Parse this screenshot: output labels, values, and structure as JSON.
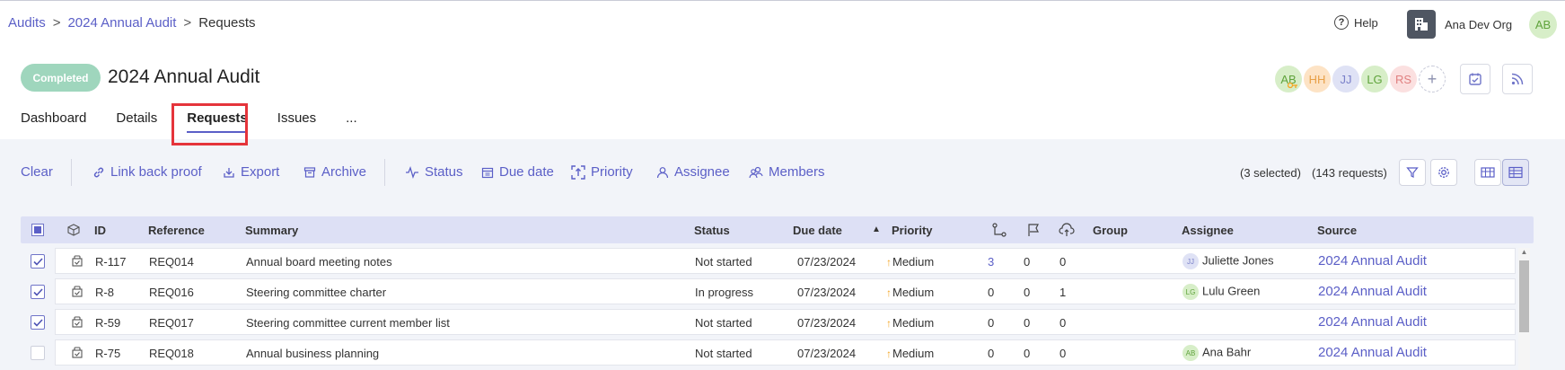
{
  "breadcrumb": {
    "root": "Audits",
    "sep1": ">",
    "parent": "2024 Annual Audit",
    "sep2": ">",
    "current": "Requests"
  },
  "topbar": {
    "help_label": "Help",
    "org_name": "Ana Dev Org",
    "user_initials": "AB"
  },
  "header": {
    "status": "Completed",
    "title": "2024 Annual Audit",
    "members": [
      {
        "initials": "AB",
        "bg": "#d7eec8",
        "fg": "#5fa33b"
      },
      {
        "initials": "HH",
        "bg": "#fde3c5",
        "fg": "#e8a047"
      },
      {
        "initials": "JJ",
        "bg": "#dfe2f5",
        "fg": "#7a80c9"
      },
      {
        "initials": "LG",
        "bg": "#d7eec8",
        "fg": "#5fa33b"
      },
      {
        "initials": "RS",
        "bg": "#fbe0e0",
        "fg": "#e08080"
      }
    ],
    "add_member": "+"
  },
  "tabs": [
    {
      "label": "Dashboard",
      "active": false
    },
    {
      "label": "Details",
      "active": false
    },
    {
      "label": "Requests",
      "active": true
    },
    {
      "label": "Issues",
      "active": false
    },
    {
      "label": "...",
      "active": false
    }
  ],
  "toolbar": {
    "clear": "Clear",
    "link_back_proof": "Link back proof",
    "export": "Export",
    "archive": "Archive",
    "status": "Status",
    "due_date": "Due date",
    "priority": "Priority",
    "assignee": "Assignee",
    "members": "Members",
    "selected_count": "(3 selected)",
    "request_count": "(143 requests)"
  },
  "table": {
    "headers": {
      "id": "ID",
      "reference": "Reference",
      "summary": "Summary",
      "status": "Status",
      "due_date": "Due date",
      "priority": "Priority",
      "group": "Group",
      "assignee": "Assignee",
      "source": "Source"
    },
    "rows": [
      {
        "checked": true,
        "id": "R-117",
        "reference": "REQ014",
        "summary": "Annual board meeting notes",
        "status": "Not started",
        "due_date": "07/23/2024",
        "priority": "Medium",
        "subtasks": "3",
        "flags": "0",
        "uploads": "0",
        "group": "",
        "assignee_initials": "JJ",
        "assignee": "Juliette Jones",
        "source": "2024 Annual Audit"
      },
      {
        "checked": true,
        "id": "R-8",
        "reference": "REQ016",
        "summary": "Steering committee charter",
        "status": "In progress",
        "due_date": "07/23/2024",
        "priority": "Medium",
        "subtasks": "0",
        "flags": "0",
        "uploads": "1",
        "group": "",
        "assignee_initials": "LG",
        "assignee": "Lulu Green",
        "source": "2024 Annual Audit"
      },
      {
        "checked": true,
        "id": "R-59",
        "reference": "REQ017",
        "summary": "Steering committee current member list",
        "status": "Not started",
        "due_date": "07/23/2024",
        "priority": "Medium",
        "subtasks": "0",
        "flags": "0",
        "uploads": "0",
        "group": "",
        "assignee_initials": "",
        "assignee": "",
        "source": "2024 Annual Audit"
      },
      {
        "checked": false,
        "id": "R-75",
        "reference": "REQ018",
        "summary": "Annual business planning",
        "status": "Not started",
        "due_date": "07/23/2024",
        "priority": "Medium",
        "subtasks": "0",
        "flags": "0",
        "uploads": "0",
        "group": "",
        "assignee_initials": "AB",
        "assignee": "Ana Bahr",
        "source": "2024 Annual Audit"
      }
    ]
  },
  "colors": {
    "accent": "#5b5fc7",
    "completed": "#9fd6bd",
    "priority_medium": "#f5a623",
    "highlight": "#e5343b"
  }
}
